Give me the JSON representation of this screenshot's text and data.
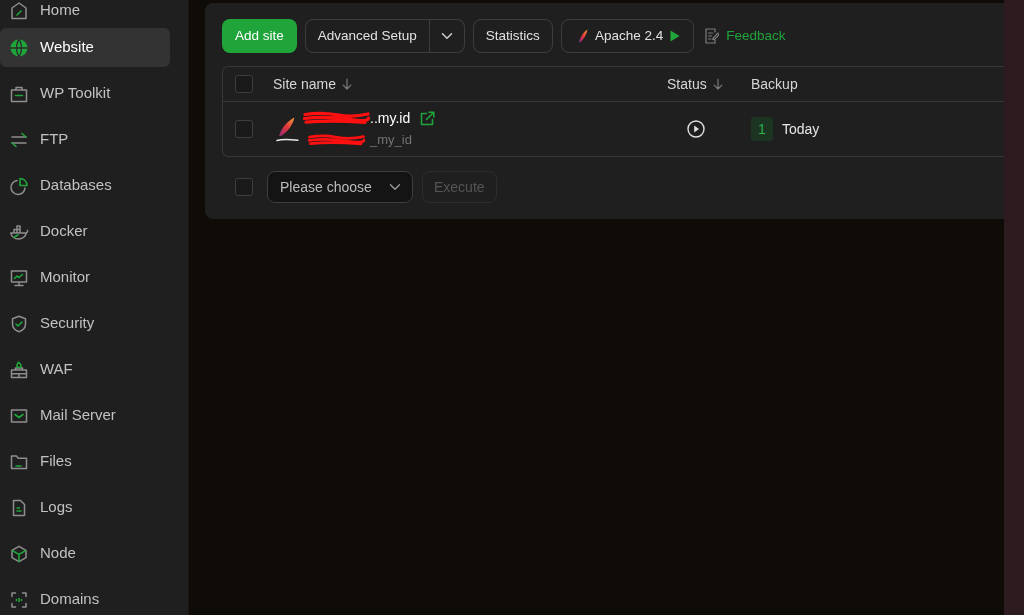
{
  "sidebar": {
    "items": [
      {
        "label": "Home",
        "selected": false
      },
      {
        "label": "Website",
        "selected": true
      },
      {
        "label": "WP Toolkit",
        "selected": false
      },
      {
        "label": "FTP",
        "selected": false
      },
      {
        "label": "Databases",
        "selected": false
      },
      {
        "label": "Docker",
        "selected": false
      },
      {
        "label": "Monitor",
        "selected": false
      },
      {
        "label": "Security",
        "selected": false
      },
      {
        "label": "WAF",
        "selected": false
      },
      {
        "label": "Mail Server",
        "selected": false
      },
      {
        "label": "Files",
        "selected": false
      },
      {
        "label": "Logs",
        "selected": false
      },
      {
        "label": "Node",
        "selected": false
      },
      {
        "label": "Domains",
        "selected": false
      }
    ]
  },
  "toolbar": {
    "add_site": "Add site",
    "advanced_setup": "Advanced Setup",
    "statistics": "Statistics",
    "web_server": "Apache 2.4",
    "feedback": "Feedback"
  },
  "table": {
    "select_all_checked": false,
    "columns": [
      {
        "label": "Site name",
        "sortable": true
      },
      {
        "label": "Status",
        "sortable": true
      },
      {
        "label": "Backup",
        "sortable": false
      }
    ],
    "rows": [
      {
        "checked": false,
        "name": "..my.id",
        "path": "_my_id",
        "backup_count": "1",
        "backup_time": "Today"
      }
    ]
  },
  "batch": {
    "checked": false,
    "action": {
      "placeholder": "Please choose"
    },
    "execute": {
      "label": "Execute",
      "disabled": true
    }
  }
}
